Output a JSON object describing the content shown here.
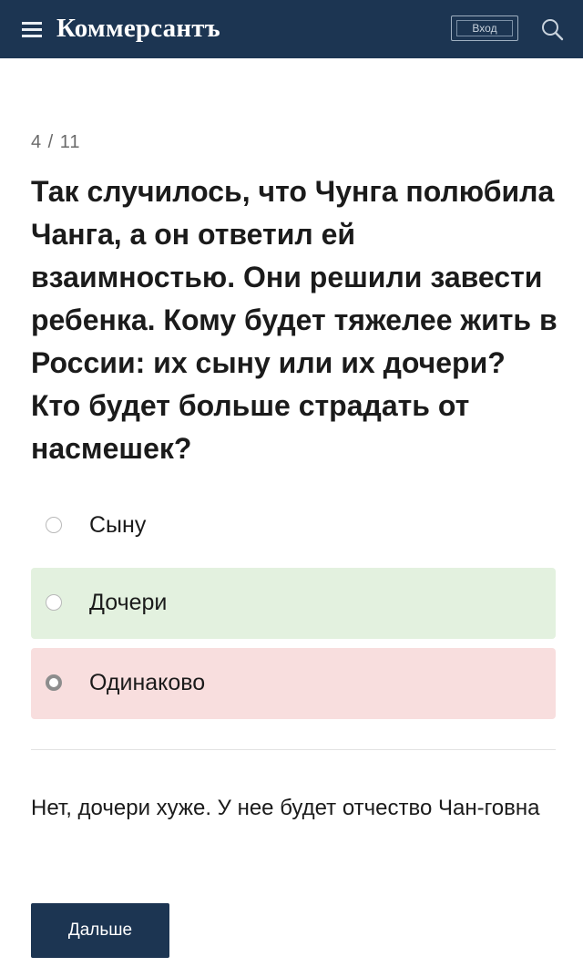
{
  "header": {
    "menu_icon": "hamburger-menu-icon",
    "brand": "Коммерсантъ",
    "login_label": "Вход",
    "search_icon": "search-icon",
    "background_color": "#1c3552"
  },
  "quiz": {
    "counter": "4 / 11",
    "question": "Так случилось, что Чунга полюбила Чанга, а он ответил ей взаимностью. Они решили завести ребенка. Кому будет тяжелее жить в России: их сыну или их дочери? Кто будет больше страдать от насмешек?",
    "options": [
      {
        "label": "Сыну",
        "selected": false,
        "state": "neutral"
      },
      {
        "label": "Дочери",
        "selected": false,
        "state": "correct",
        "color": "#e3f1df"
      },
      {
        "label": "Одинаково",
        "selected": true,
        "state": "wrong",
        "color": "#f8dede"
      }
    ],
    "explanation": "Нет, дочери хуже. У нее будет отчество Чан-говна",
    "next_label": "Дальше"
  }
}
